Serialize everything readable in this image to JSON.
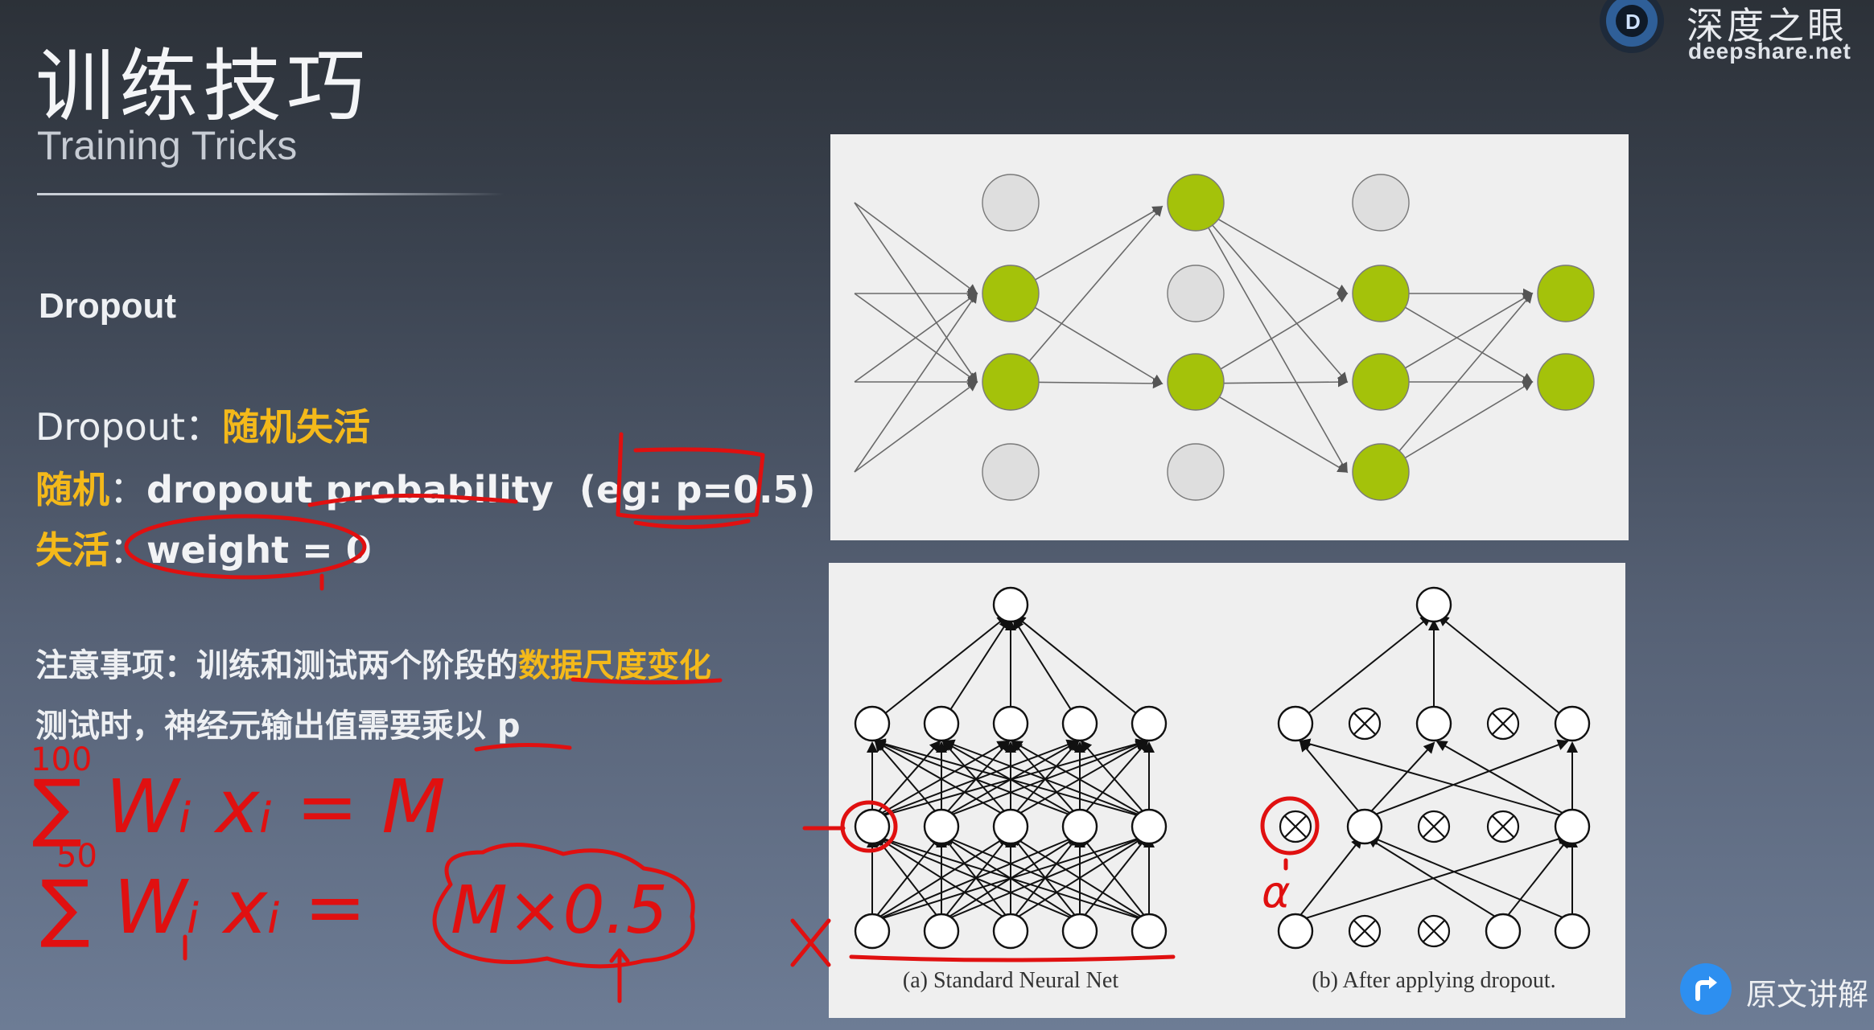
{
  "title": {
    "cn": "训练技巧",
    "en": "Training Tricks"
  },
  "brand": {
    "cn": "深度之眼",
    "url": "deepshare.net"
  },
  "section_heading": "Dropout",
  "definition": {
    "term": "Dropout：",
    "term_value": "随机失活",
    "random_label": "随机",
    "random_sep": "：",
    "random_text_a": "dropout probability",
    "random_text_b": "  (eg: p=0.5)",
    "deactivate_label": "失活",
    "deactivate_sep": "：",
    "deactivate_text": "weight = 0"
  },
  "notes": {
    "line1_prefix": "注意事项：训练和测试两个阶段的",
    "line1_highlight": "数据尺度变化",
    "line2": "测试时，神经元输出值需要乘以 p"
  },
  "handwriting": {
    "sum1_upper": "100",
    "sum1": "∑ Wᵢ xᵢ = M",
    "sum2_upper": "50",
    "sum2": "∑ Wᵢ xᵢ =",
    "result": "M×0.5",
    "alpha": "α",
    "cross": "X"
  },
  "figure_captions": {
    "a": "(a) Standard Neural Net",
    "b": "(b) After applying dropout."
  },
  "original_button_label": "原文讲解",
  "colors": {
    "accent_yellow": "#f4b91a",
    "node_green": "#a4c20a",
    "node_gray": "#dcdcdc",
    "ink_red": "#e01010"
  }
}
